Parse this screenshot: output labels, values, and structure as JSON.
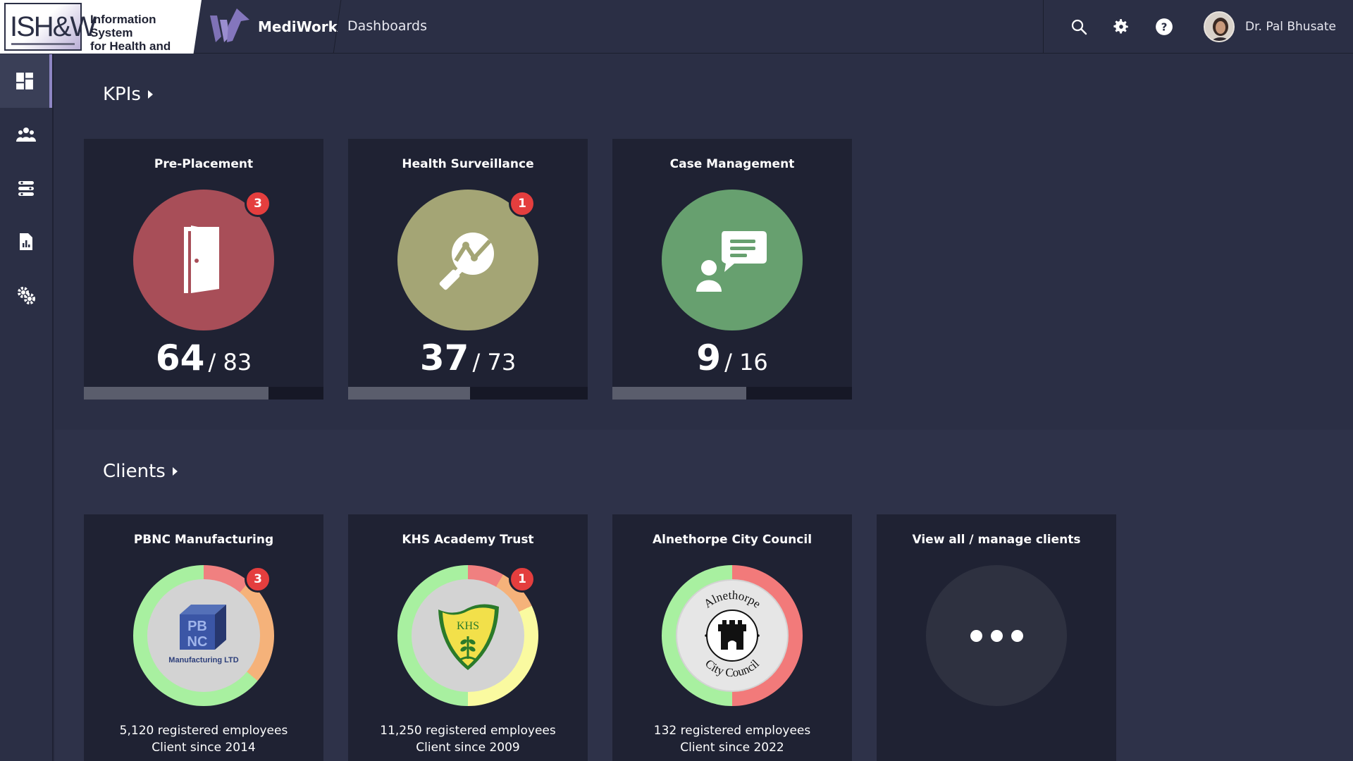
{
  "header": {
    "brand_mark": "ISH&W",
    "brand_line1": "Information System",
    "brand_line2": "for Health and Work",
    "app_name": "MediWork",
    "breadcrumb": "Dashboards",
    "user_name": "Dr. Pal Bhusate",
    "icons": [
      "search-icon",
      "settings-icon",
      "help-icon"
    ]
  },
  "sidebar": {
    "items": [
      {
        "icon": "dashboard-icon",
        "active": true
      },
      {
        "icon": "people-icon",
        "active": false
      },
      {
        "icon": "workflow-icon",
        "active": false
      },
      {
        "icon": "report-icon",
        "active": false
      },
      {
        "icon": "admin-settings-icon",
        "active": false
      }
    ]
  },
  "kpis": {
    "title": "KPIs",
    "cards": [
      {
        "title": "Pre-Placement",
        "badge": "3",
        "value": "64",
        "total": "/ 83",
        "progress": 0.771,
        "color": "#a84e58",
        "icon": "door-icon"
      },
      {
        "title": "Health Surveillance",
        "badge": "1",
        "value": "37",
        "total": "/ 73",
        "progress": 0.507,
        "color": "#a4a575",
        "icon": "magnifier-chart-icon"
      },
      {
        "title": "Case Management",
        "badge": "",
        "value": "9",
        "total": "/ 16",
        "progress": 0.5625,
        "color": "#67a06f",
        "icon": "person-chat-icon"
      }
    ]
  },
  "clients": {
    "title": "Clients",
    "cards": [
      {
        "title": "PBNC Manufacturing",
        "badge": "3",
        "logo_text": "PB NC",
        "logo_sub": "Manufacturing LTD",
        "employees": "5,120 registered employees",
        "since": "Client since 2014"
      },
      {
        "title": "KHS Academy Trust",
        "badge": "1",
        "logo_text": "KHS",
        "employees": "11,250 registered employees",
        "since": "Client since 2009"
      },
      {
        "title": "Alnethorpe City Council",
        "badge": "",
        "logo_top": "Alnethorpe",
        "logo_bottom": "City Council",
        "employees": "132 registered employees",
        "since": "Client since 2022"
      },
      {
        "title": "View all / manage clients"
      }
    ]
  },
  "colors": {
    "background": "#2b2f45",
    "card": "#1f2233",
    "badge": "#e43e3e",
    "accent": "#8e86c4"
  }
}
